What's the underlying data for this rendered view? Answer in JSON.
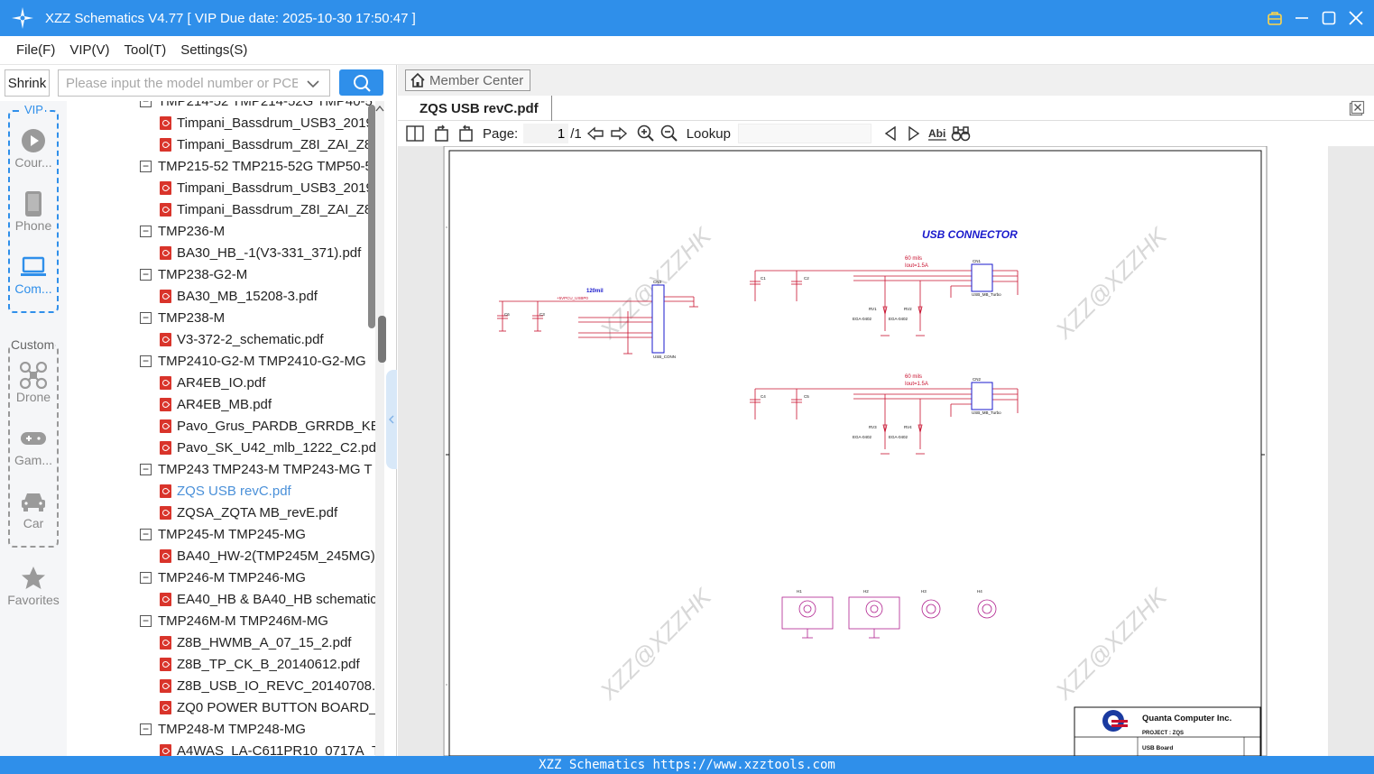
{
  "window": {
    "title": "XZZ Schematics V4.77 [ VIP Due date: 2025-10-30 17:50:47 ]"
  },
  "menu": [
    "File(F)",
    "VIP(V)",
    "Tool(T)",
    "Settings(S)"
  ],
  "left": {
    "shrink_label": "Shrink",
    "search_placeholder": "Please input the model number or PCB"
  },
  "sidenav": {
    "vip_label": "VIP",
    "custom_label": "Custom",
    "favorites_label": "Favorites",
    "items": [
      {
        "label": "Cour...",
        "icon": "play-icon"
      },
      {
        "label": "Phone",
        "icon": "phone-icon"
      },
      {
        "label": "Com...",
        "icon": "laptop-icon"
      },
      {
        "label": "Drone",
        "icon": "drone-icon"
      },
      {
        "label": "Gam...",
        "icon": "gamepad-icon"
      },
      {
        "label": "Car",
        "icon": "car-icon"
      }
    ]
  },
  "tree": [
    {
      "type": "folder",
      "text": "TMP214-52 TMP214-52G TMP40-5"
    },
    {
      "type": "file",
      "text": "Timpani_Bassdrum_USB3_20190"
    },
    {
      "type": "file",
      "text": "Timpani_Bassdrum_Z8I_ZAI_Z8J"
    },
    {
      "type": "folder",
      "text": "TMP215-52 TMP215-52G TMP50-5"
    },
    {
      "type": "file",
      "text": "Timpani_Bassdrum_USB3_20190"
    },
    {
      "type": "file",
      "text": "Timpani_Bassdrum_Z8I_ZAI_Z8J"
    },
    {
      "type": "folder",
      "text": "TMP236-M"
    },
    {
      "type": "file",
      "text": "BA30_HB_-1(V3-331_371).pdf"
    },
    {
      "type": "folder",
      "text": "TMP238-G2-M"
    },
    {
      "type": "file",
      "text": "BA30_MB_15208-3.pdf"
    },
    {
      "type": "folder",
      "text": "TMP238-M"
    },
    {
      "type": "file",
      "text": "V3-372-2_schematic.pdf"
    },
    {
      "type": "folder",
      "text": "TMP2410-G2-M TMP2410-G2-MG"
    },
    {
      "type": "file",
      "text": "AR4EB_IO.pdf"
    },
    {
      "type": "file",
      "text": "AR4EB_MB.pdf"
    },
    {
      "type": "file",
      "text": "Pavo_Grus_PARDB_GRRDB_KBL_"
    },
    {
      "type": "file",
      "text": "Pavo_SK_U42_mlb_1222_C2.pdf"
    },
    {
      "type": "folder",
      "text": "TMP243 TMP243-M TMP243-MG T"
    },
    {
      "type": "file",
      "text": "ZQS USB revC.pdf",
      "selected": true
    },
    {
      "type": "file",
      "text": "ZQSA_ZQTA MB_revE.pdf"
    },
    {
      "type": "folder",
      "text": "TMP245-M TMP245-MG"
    },
    {
      "type": "file",
      "text": "BA40_HW-2(TMP245M_245MG)"
    },
    {
      "type": "folder",
      "text": "TMP246-M TMP246-MG"
    },
    {
      "type": "file",
      "text": "EA40_HB & BA40_HB schematic"
    },
    {
      "type": "folder",
      "text": "TMP246M-M TMP246M-MG"
    },
    {
      "type": "file",
      "text": "Z8B_HWMB_A_07_15_2.pdf"
    },
    {
      "type": "file",
      "text": "Z8B_TP_CK_B_20140612.pdf"
    },
    {
      "type": "file",
      "text": "Z8B_USB_IO_REVC_20140708.pd"
    },
    {
      "type": "file",
      "text": "ZQ0 POWER BUTTON BOARD_B"
    },
    {
      "type": "folder",
      "text": "TMP248-M TMP248-MG"
    },
    {
      "type": "file",
      "text": "A4WAS_LA-C611PR10_0717A_To"
    }
  ],
  "viewer": {
    "member_center": "Member Center",
    "tab_title": "ZQS USB revC.pdf",
    "page_label": "Page:",
    "page_value": "1",
    "page_total": "/1",
    "lookup_label": "Lookup"
  },
  "schematic": {
    "heading": "USB CONNECTOR",
    "watermark": "XZZ@XZZHK",
    "company": "Quanta Computer Inc.",
    "project": "PROJECT : ZQS",
    "board": "USB Board",
    "l1": "120mil",
    "l2": "+5VPCU_USBP0",
    "l3": "60 mils",
    "l4": "Iout=1.5A",
    "c1": "C1",
    "c2": "C2",
    "c3": "C3",
    "c4": "C4",
    "c5": "C5",
    "c6": "C6",
    "cn1": "CN1",
    "cn2": "CN2",
    "cn3": "CN3",
    "usb_conn": "USB_CONN",
    "usb_mb_turbo": "USB_MB_Turbo",
    "ega": "EGA-0402",
    "rv1": "RV1",
    "rv2": "RV2",
    "rv3": "RV3",
    "rv4": "RV4",
    "h1": "H1",
    "h2": "H2",
    "h3": "H3",
    "h4": "H4"
  },
  "status": {
    "text": "XZZ Schematics https://www.xzztools.com"
  },
  "colors": {
    "accent": "#2f8fea",
    "pdf_red": "#d9342b",
    "schematic_red": "#c8102e",
    "schematic_blue": "#1a1acc",
    "schematic_magenta": "#b0208e"
  }
}
